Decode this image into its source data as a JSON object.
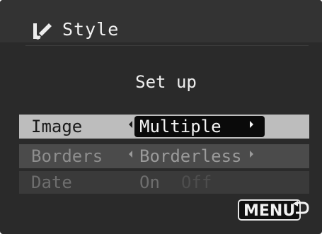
{
  "header": {
    "title": "Style",
    "icon": "brush-icon"
  },
  "subtitle": "Set up",
  "settings": [
    {
      "label": "Image",
      "value": "Multiple",
      "state": "selected"
    },
    {
      "label": "Borders",
      "value": "Borderless",
      "state": "normal"
    },
    {
      "label": "Date",
      "options": [
        "On",
        "Off"
      ],
      "selected_option": "On",
      "state": "disabled"
    }
  ],
  "footer": {
    "menu_label": "MENU",
    "return_icon": "return-arrow-icon"
  },
  "colors": {
    "screen_bg": "#2a2a2a",
    "selected_row_bg": "#bdbdbd",
    "value_pill_bg": "#0a0a0a"
  }
}
